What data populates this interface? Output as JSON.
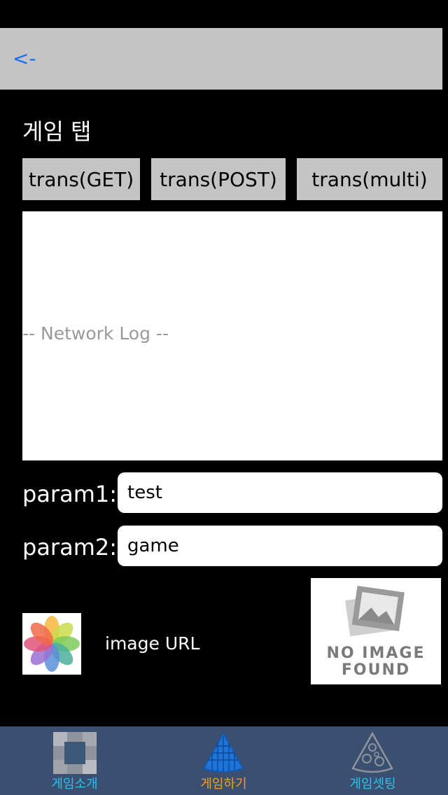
{
  "nav": {
    "back_label": "<-"
  },
  "page": {
    "title": "게임 탭"
  },
  "buttons": {
    "get_label": "trans(GET)",
    "post_label": "trans(POST)",
    "multi_label": "trans(multi)"
  },
  "log": {
    "placeholder": "-- Network Log --"
  },
  "params": [
    {
      "label": "param1:",
      "value": "test"
    },
    {
      "label": "param2:",
      "value": "game"
    }
  ],
  "image": {
    "url_label": "image URL",
    "no_image_text": "NO IMAGE\nFOUND"
  },
  "tabs": [
    {
      "label": "게임소개",
      "color": "#28c3f0",
      "icon": "tile-icon"
    },
    {
      "label": "게임하기",
      "color": "#f0a020",
      "icon": "pizza-slice-icon"
    },
    {
      "label": "게임셋팅",
      "color": "#28c3f0",
      "icon": "pizza-outline-icon"
    }
  ],
  "colors": {
    "background": "#000000",
    "nav_bar": "#c4c4c4",
    "back_link": "#1a6ef5",
    "tab_bar": "#3b5070",
    "tab_active": "#f0a020",
    "tab_inactive": "#28c3f0"
  }
}
